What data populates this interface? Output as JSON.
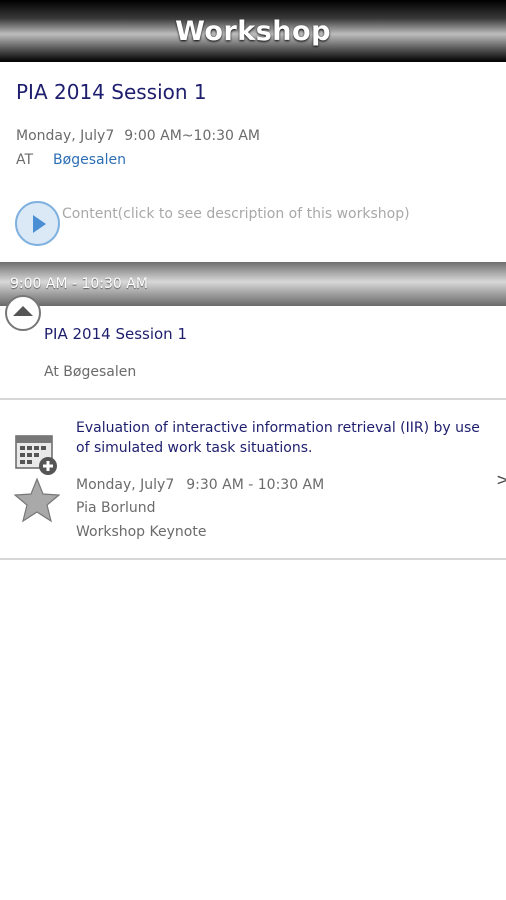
{
  "header": {
    "title": "Workshop"
  },
  "session": {
    "title": "PIA 2014 Session 1",
    "date": "Monday, July7",
    "time": "9:00 AM~10:30 AM",
    "at_label": "AT",
    "room": "Bøgesalen",
    "content_link": "Content(click to see description of this workshop)"
  },
  "timeslot": {
    "label": "9:00 AM - 10:30 AM",
    "title": "PIA 2014 Session 1",
    "location": "At Bøgesalen"
  },
  "talk": {
    "title": "Evaluation of interactive information retrieval (IIR) by use of simulated work task situations.",
    "date": "Monday, July7",
    "time": "9:30 AM - 10:30 AM",
    "speaker": "Pia Borlund",
    "type": "Workshop Keynote",
    "chevron": ">"
  },
  "icons": {
    "play": "play-icon",
    "collapse": "chevron-up-icon",
    "calendar_add": "calendar-add-icon",
    "favorite": "star-icon"
  }
}
